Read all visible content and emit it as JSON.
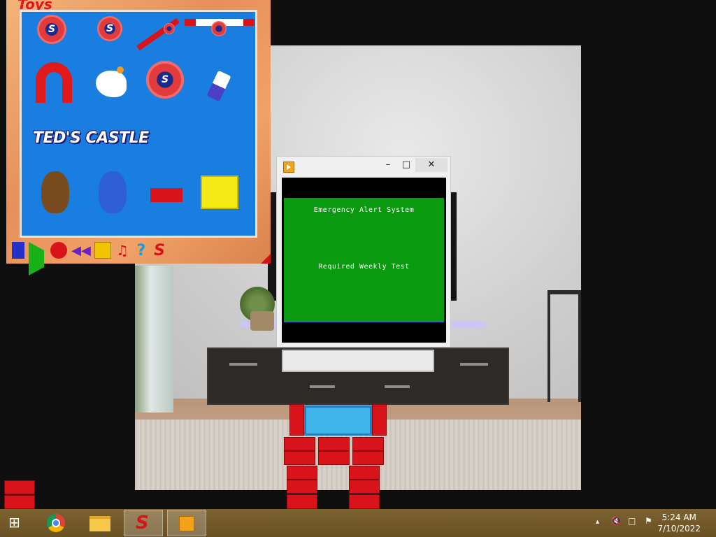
{
  "toybox": {
    "logo_text": "Toys",
    "gear_letter": "S",
    "castle_label": "TED'S CASTLE",
    "toolbar": {
      "help_glyph": "?",
      "s_glyph": "S"
    }
  },
  "player": {
    "minimize_glyph": "–",
    "maximize_glyph": "□",
    "close_glyph": "✕",
    "screen_line1": "Emergency Alert System",
    "screen_line2": "Required Weekly Test"
  },
  "taskbar": {
    "pinned": [
      "windows-start",
      "chrome",
      "file-explorer",
      "crazy-machines-s",
      "media-player"
    ],
    "tray_icons": [
      "show-hidden-chevron",
      "speaker-muted",
      "network-error",
      "action-center-flag"
    ],
    "time": "5:24 AM",
    "date": "7/10/2022",
    "start_glyph": "⊞",
    "chevron_glyph": "▴"
  },
  "colors": {
    "alert_green": "#0a9a0f",
    "toy_blue": "#1a7ee0",
    "block_red": "#d8141a",
    "taskbar_brown": "#7c6230"
  }
}
